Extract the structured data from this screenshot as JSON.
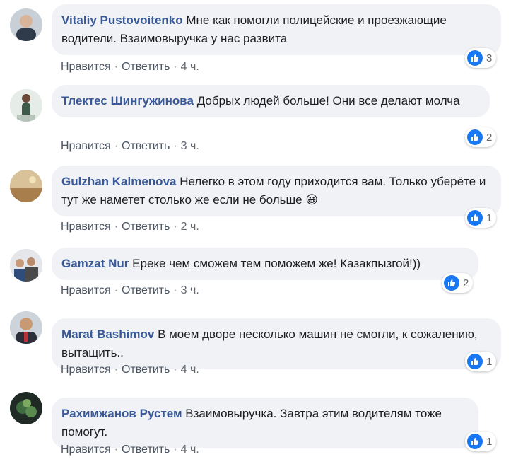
{
  "ui": {
    "like_label": "Нравится",
    "reply_label": "Ответить",
    "separator": "·"
  },
  "colors": {
    "author": "#385898",
    "bubble": "#f0f2f5",
    "like": "#1877f2"
  },
  "comments": [
    {
      "author": "Vitaliy Pustovoitenko",
      "text": "Мне как помогли полицейские и проезжающие водители. Взаимовыручка у нас развита",
      "time": "4 ч.",
      "reactions": "3"
    },
    {
      "author": "Тлектес Шингужинова",
      "text": "Добрых людей больше! Они все делают молча",
      "time": "3 ч.",
      "reactions": "2"
    },
    {
      "author": "Gulzhan Kalmenova",
      "text": "Нелегко в этом году приходится вам. Только уберёте и тут же наметет столько же если не больше",
      "emoji": "😀",
      "time": "2 ч.",
      "reactions": "1"
    },
    {
      "author": "Gamzat Nur",
      "text": "Ереке чем сможем тем поможем же! Казакпызгой!))",
      "time": "3 ч.",
      "reactions": "2"
    },
    {
      "author": "Marat Bashimov",
      "text": "В моем дворе несколько машин не смогли, к сожалению, вытащить..",
      "time": "4 ч.",
      "reactions": "1"
    },
    {
      "author": "Рахимжанов Рустем",
      "text": "Взаимовыручка. Завтра этим водителям тоже помогут.",
      "time": "4 ч.",
      "reactions": "1"
    }
  ]
}
